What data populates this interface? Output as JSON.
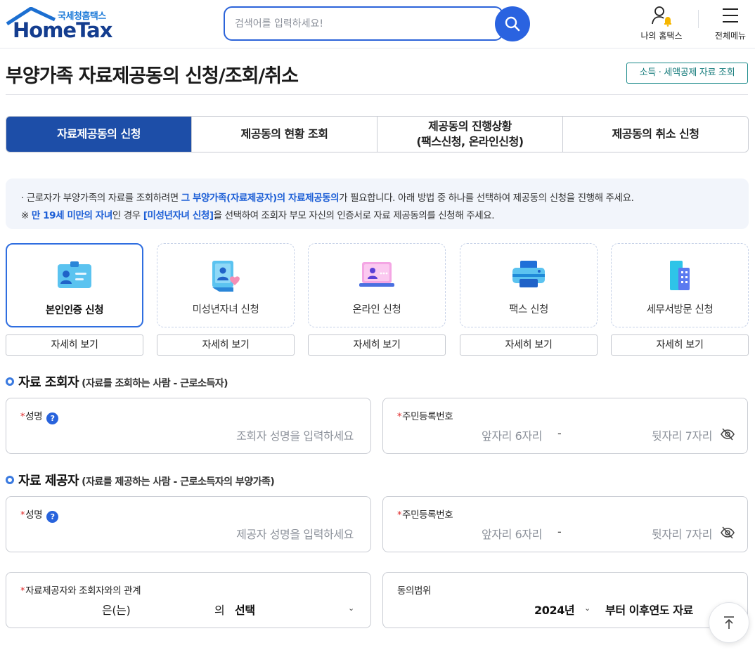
{
  "header": {
    "logo_kr": "국세청홈택스",
    "logo_en": "HomeTax",
    "search_placeholder": "검색어를 입력하세요!",
    "my_hometax": "나의 홈택스",
    "all_menu": "전체메뉴"
  },
  "page": {
    "title": "부양가족 자료제공동의 신청/조회/취소",
    "title_link": "소득 · 세액공제 자료 조회"
  },
  "tabs": [
    {
      "label": "자료제공동의 신청",
      "active": true
    },
    {
      "label": "제공동의 현황 조회",
      "active": false
    },
    {
      "label": "제공동의 진행상황",
      "label2": "(팩스신청, 온라인신청)",
      "active": false
    },
    {
      "label": "제공동의 취소 신청",
      "active": false
    }
  ],
  "notice": {
    "line1_a": "· 근로자가 부양가족의 자료를 조회하려면 ",
    "line1_hl": "그 부양가족(자료제공자)의 자료제공동의",
    "line1_b": "가 필요합니다. 아래 방법 중 하나를 선택하여 제공동의 신청을 진행해 주세요.",
    "line2_a": "※ ",
    "line2_hl": "만 19세 미만의 자녀",
    "line2_b": "인 경우 ",
    "line2_hl2": "[미성년자녀 신청]",
    "line2_c": "을 선택하여 조회자 부모 자신의 인증서로 자료 제공동의를 신청해 주세요."
  },
  "methods": [
    {
      "label": "본인인증 신청",
      "icon": "id-card-icon",
      "detail": "자세히 보기",
      "active": true
    },
    {
      "label": "미성년자녀 신청",
      "icon": "child-heart-icon",
      "detail": "자세히 보기",
      "active": false
    },
    {
      "label": "온라인 신청",
      "icon": "laptop-icon",
      "detail": "자세히 보기",
      "active": false
    },
    {
      "label": "팩스 신청",
      "icon": "fax-icon",
      "detail": "자세히 보기",
      "active": false
    },
    {
      "label": "세무서방문 신청",
      "icon": "building-icon",
      "detail": "자세히 보기",
      "active": false
    }
  ],
  "viewer": {
    "title": "자료 조회자",
    "subtitle": "(자료를 조회하는 사람 - 근로소득자)",
    "name_label": "성명",
    "name_placeholder": "조회자 성명을 입력하세요",
    "rrn_label": "주민등록번호",
    "rrn_front_placeholder": "앞자리 6자리",
    "rrn_dash": "-",
    "rrn_back_placeholder": "뒷자리 7자리"
  },
  "provider": {
    "title": "자료 제공자",
    "subtitle": "(자료를 제공하는 사람 - 근로소득자의 부양가족)",
    "name_label": "성명",
    "name_placeholder": "제공자 성명을 입력하세요",
    "rrn_label": "주민등록번호",
    "rrn_front_placeholder": "앞자리 6자리",
    "rrn_dash": "-",
    "rrn_back_placeholder": "뒷자리 7자리"
  },
  "relation": {
    "label": "자료제공자와 조회자와의 관계",
    "part1": "은(는)",
    "part2": "의",
    "select_value": "선택"
  },
  "scope": {
    "label": "동의범위",
    "year_value": "2024년",
    "suffix": "부터 이후연도 자료"
  },
  "colors": {
    "brand_blue": "#1d4ea8",
    "accent_blue": "#2a63e0",
    "teal": "#137a7a",
    "required_red": "#e02828"
  }
}
